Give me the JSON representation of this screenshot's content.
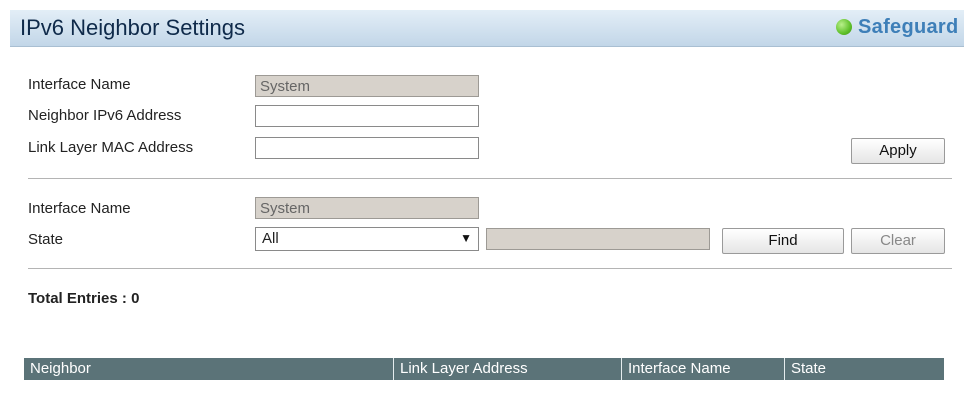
{
  "header": {
    "title": "IPv6 Neighbor Settings",
    "brand": "Safeguard",
    "brand_color": "#3e7fb8",
    "status_dot_color": "#5fc02a"
  },
  "settings_form": {
    "interface_name_label": "Interface Name",
    "interface_name_value": "System",
    "neighbor_ipv6_label": "Neighbor IPv6 Address",
    "neighbor_ipv6_value": "",
    "link_layer_mac_label": "Link Layer MAC Address",
    "link_layer_mac_value": "",
    "apply_label": "Apply"
  },
  "filter_form": {
    "interface_name_label": "Interface Name",
    "interface_name_value": "System",
    "state_label": "State",
    "state_selected": "All",
    "state_value": "",
    "find_label": "Find",
    "clear_label": "Clear"
  },
  "summary": {
    "total_entries": "Total Entries : 0"
  },
  "table": {
    "header_color": "#5b7378",
    "columns": [
      "Neighbor",
      "Link Layer Address",
      "Interface Name",
      "State"
    ],
    "rows": []
  }
}
